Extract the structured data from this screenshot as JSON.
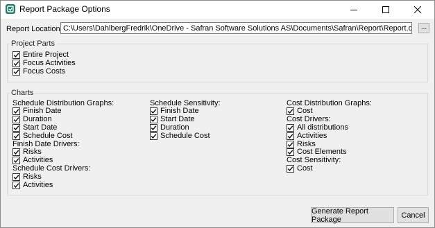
{
  "window": {
    "title": "Report Package Options",
    "icon": "report-package-app-icon"
  },
  "report_location": {
    "label": "Report Location:",
    "value": "C:\\Users\\DahlbergFredrik\\OneDrive - Safran Software Solutions AS\\Documents\\Safran\\Report\\Report.docx",
    "browse_label": "..."
  },
  "project_parts": {
    "title": "Project Parts",
    "items": [
      {
        "label": "Entire Project",
        "checked": true
      },
      {
        "label": "Focus Activities",
        "checked": true
      },
      {
        "label": "Focus Costs",
        "checked": true
      }
    ]
  },
  "charts": {
    "title": "Charts",
    "col1": {
      "h1": "Schedule Distribution Graphs:",
      "sdg": [
        "Finish Date",
        "Duration",
        "Start Date",
        "Schedule Cost"
      ],
      "h2": "Finish Date Drivers:",
      "fdd": [
        "Risks",
        "Activities"
      ],
      "h3": "Schedule Cost Drivers:",
      "scd": [
        "Risks",
        "Activities"
      ]
    },
    "col2": {
      "h1": "Schedule Sensitivity:",
      "ss": [
        "Finish Date",
        "Start Date",
        "Duration",
        "Schedule Cost"
      ]
    },
    "col3": {
      "h1": "Cost Distribution Graphs:",
      "cdg": [
        "Cost"
      ],
      "h2": "Cost Drivers:",
      "cd": [
        "All distributions",
        "Activities",
        "Risks",
        "Cost Elements"
      ],
      "h3": "Cost Sensitivity:",
      "cs": [
        "Cost"
      ]
    }
  },
  "footer": {
    "generate_label": "Generate Report Package",
    "cancel_label": "Cancel"
  }
}
